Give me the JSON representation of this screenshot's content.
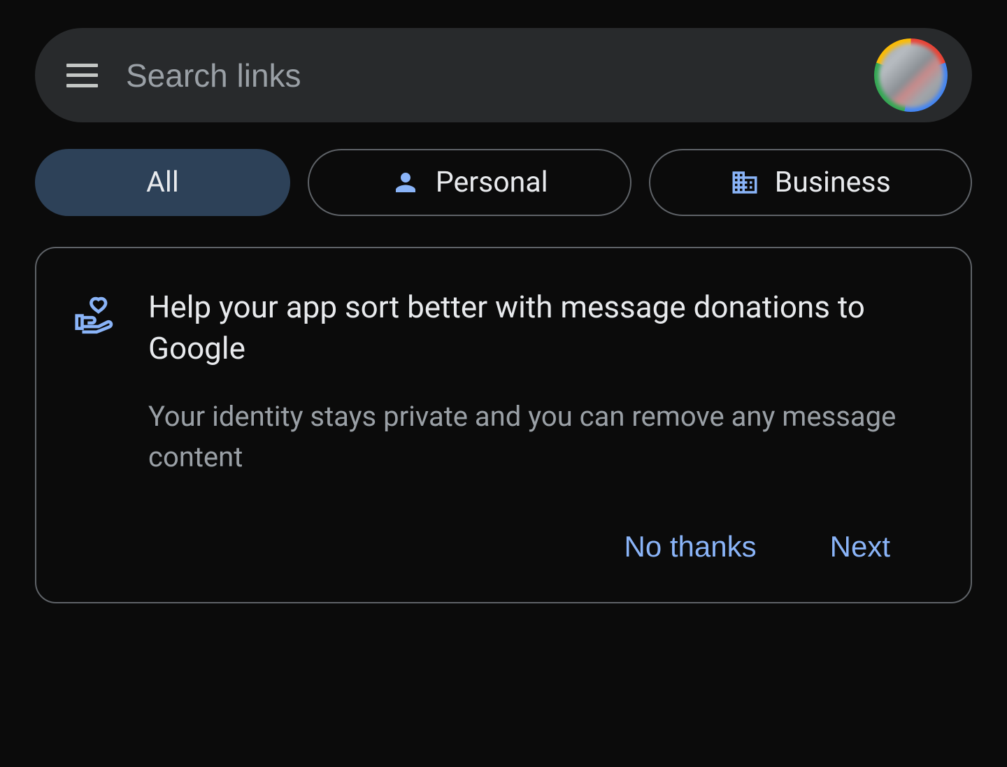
{
  "search": {
    "placeholder": "Search links"
  },
  "tabs": {
    "all": "All",
    "personal": "Personal",
    "business": "Business"
  },
  "card": {
    "title": "Help your app sort better with message donations to Google",
    "subtitle": "Your identity stays private and you can remove any message content",
    "no_thanks": "No thanks",
    "next": "Next"
  }
}
